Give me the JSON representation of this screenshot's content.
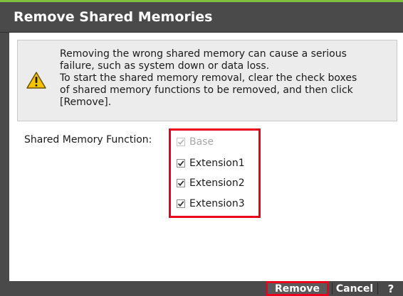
{
  "dialog": {
    "title": "Remove Shared Memories"
  },
  "warning": {
    "icon": "warning-icon",
    "lines": [
      "Removing the wrong shared memory can cause a serious",
      "failure, such as system down or data loss.",
      "To start the shared memory removal, clear the check boxes",
      "of shared memory functions to be removed, and then click",
      "[Remove]."
    ]
  },
  "form": {
    "label": "Shared Memory Function:",
    "options": [
      {
        "label": "Base",
        "checked": true,
        "disabled": true
      },
      {
        "label": "Extension1",
        "checked": true,
        "disabled": false
      },
      {
        "label": "Extension2",
        "checked": true,
        "disabled": false
      },
      {
        "label": "Extension3",
        "checked": true,
        "disabled": false
      }
    ]
  },
  "footer": {
    "remove_label": "Remove",
    "cancel_label": "Cancel",
    "help_label": "?"
  },
  "colors": {
    "titlebar": "#4a4a4a",
    "accent": "#7fbf3f",
    "highlight": "#e8001c"
  }
}
